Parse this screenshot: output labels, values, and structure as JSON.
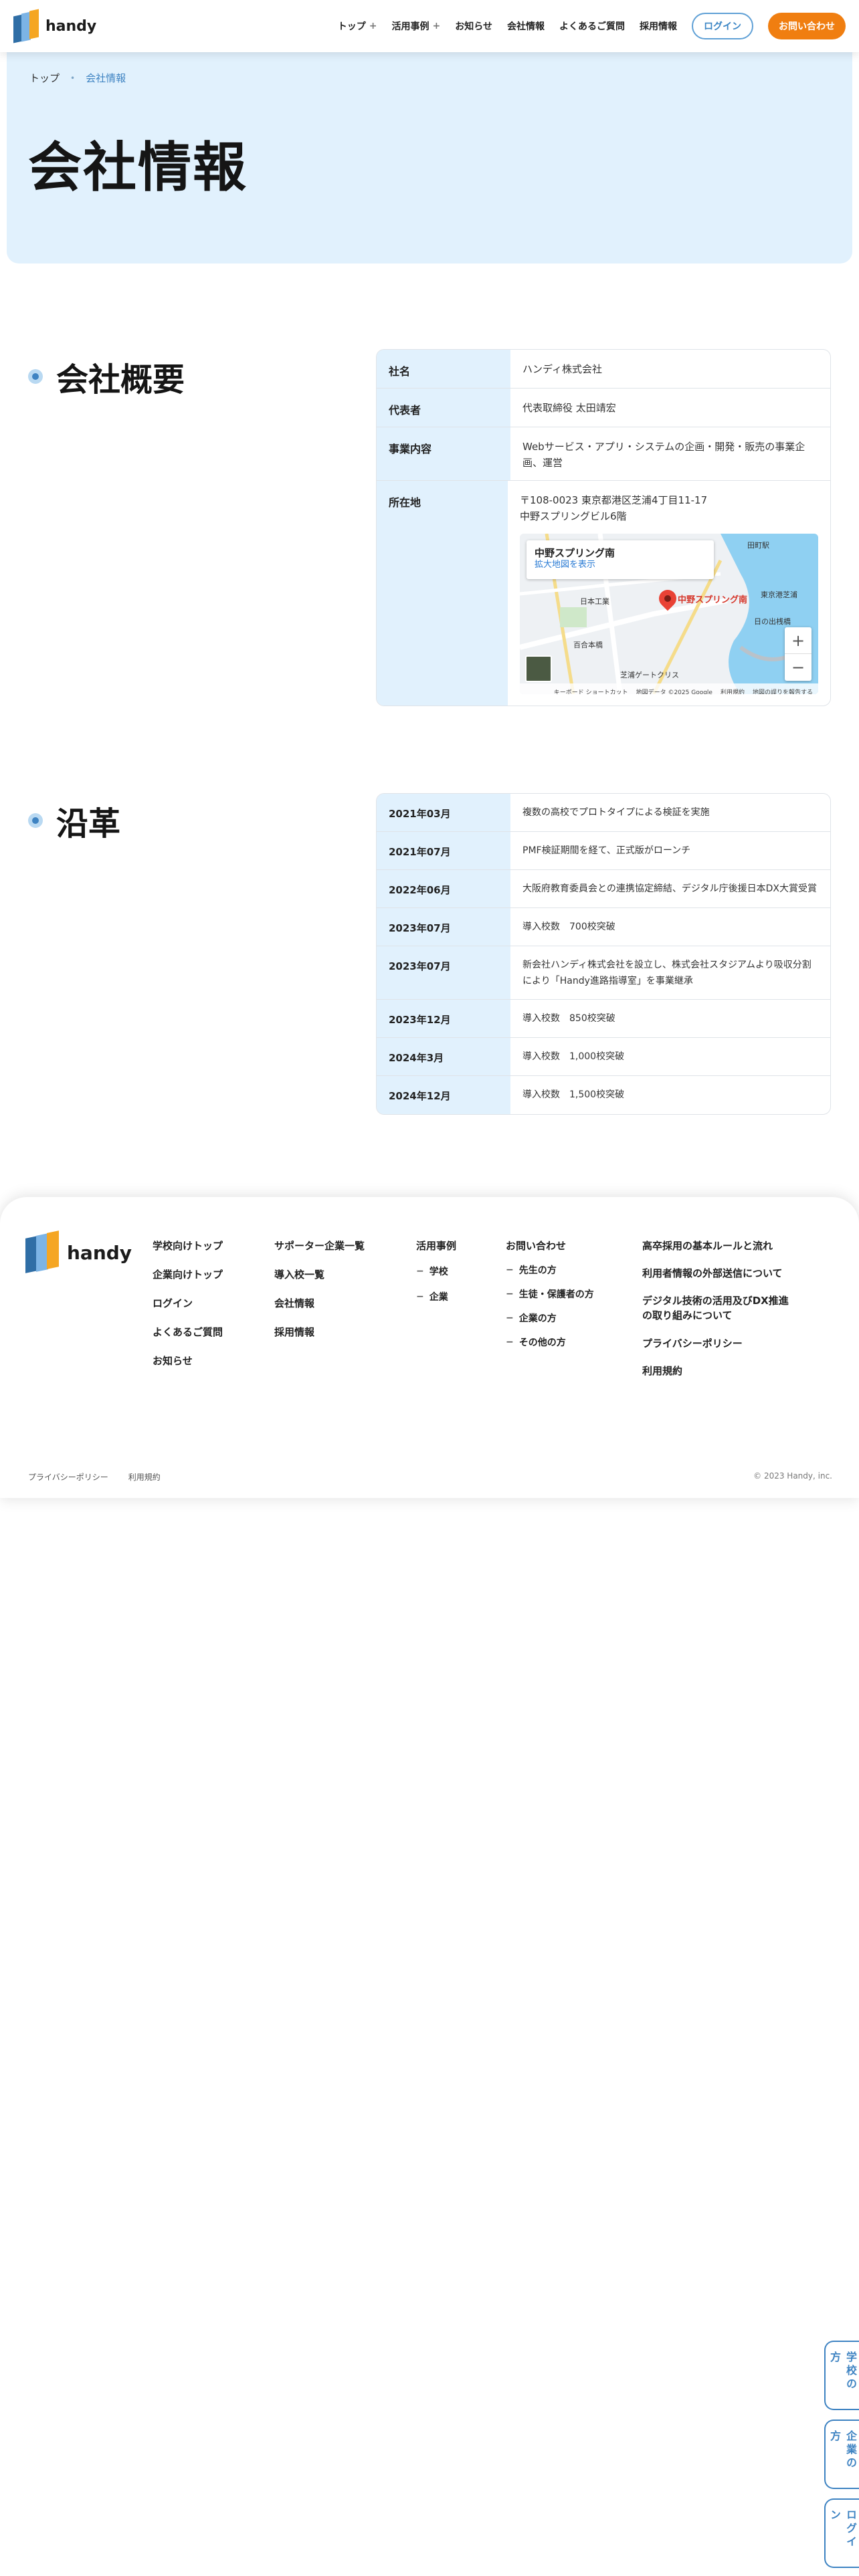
{
  "header": {
    "logo_text": "handy",
    "nav": [
      {
        "label": "トップ",
        "has_plus": true
      },
      {
        "label": "活用事例",
        "has_plus": true
      },
      {
        "label": "お知らせ",
        "has_plus": false
      },
      {
        "label": "会社情報",
        "has_plus": false
      },
      {
        "label": "よくあるご質問",
        "has_plus": false
      },
      {
        "label": "採用情報",
        "has_plus": false
      }
    ],
    "login_label": "ログイン",
    "contact_label": "お問い合わせ",
    "plus_symbol": "+"
  },
  "breadcrumb": {
    "top": "トップ",
    "sep": "•",
    "current": "会社情報"
  },
  "hero": {
    "title": "会社情報"
  },
  "overview": {
    "title": "会社概要",
    "rows": [
      {
        "label": "社名",
        "value": "ハンディ株式会社"
      },
      {
        "label": "代表者",
        "value": "代表取締役 太田靖宏"
      },
      {
        "label": "事業内容",
        "value": "Webサービス・アプリ・システムの企画・開発・販売の事業企画、運営"
      },
      {
        "label": "所在地",
        "line1": "〒108-0023 東京都港区芝浦4丁目11-17",
        "line2": "中野スプリングビル6階"
      }
    ],
    "map": {
      "place_name": "中野スプリング南",
      "enlarge_link": "拡大地図を表示",
      "pin_label": "中野スプリング南",
      "zoom_in": "+",
      "zoom_out": "−",
      "labels": [
        "田町駅",
        "日の出桟橋",
        "東京港芝浦",
        "日本工業",
        "芝浦ゲートクリス",
        "百合本橋"
      ],
      "attr": [
        "キーボード ショートカット",
        "地図データ ©2025 Google",
        "利用規約",
        "地図の誤りを報告する"
      ]
    }
  },
  "history": {
    "title": "沿革",
    "rows": [
      {
        "date": "2021年03月",
        "text": "複数の高校でプロトタイプによる検証を実施"
      },
      {
        "date": "2021年07月",
        "text": "PMF検証期間を経て、正式版がローンチ"
      },
      {
        "date": "2022年06月",
        "text": "大阪府教育委員会との連携協定締結、デジタル庁後援日本DX大賞受賞"
      },
      {
        "date": "2023年07月",
        "text": "導入校数　700校突破"
      },
      {
        "date": "2023年07月",
        "text": "新会社ハンディ株式会社を設立し、株式会社スタジアムより吸収分割により「Handy進路指導室」を事業継承"
      },
      {
        "date": "2023年12月",
        "text": "導入校数　850校突破"
      },
      {
        "date": "2024年3月",
        "text": "導入校数　1,000校突破"
      },
      {
        "date": "2024年12月",
        "text": "導入校数　1,500校突破"
      }
    ]
  },
  "footer": {
    "logo_text": "handy",
    "col1": [
      "学校向けトップ",
      "企業向けトップ",
      "ログイン",
      "よくあるご質問",
      "お知らせ"
    ],
    "col2": [
      "サポーター企業一覧",
      "導入校一覧",
      "会社情報",
      "採用情報"
    ],
    "col3_title": "活用事例",
    "col3": [
      "学校",
      "企業"
    ],
    "col4_title": "お問い合わせ",
    "col4": [
      "先生の方",
      "生徒・保護者の方",
      "企業の方",
      "その他の方"
    ],
    "col5": [
      "高卒採用の基本ルールと流れ",
      "利用者情報の外部送信について",
      "デジタル技術の活用及びDX推進の取り組みについて",
      "プライバシーポリシー",
      "利用規約"
    ],
    "bottom_links": [
      "プライバシーポリシー",
      "利用規約"
    ],
    "copyright": "© 2023 Handy, inc.",
    "dash": "−"
  },
  "side_tabs": [
    "学校の方",
    "企業の方",
    "ログイン"
  ]
}
